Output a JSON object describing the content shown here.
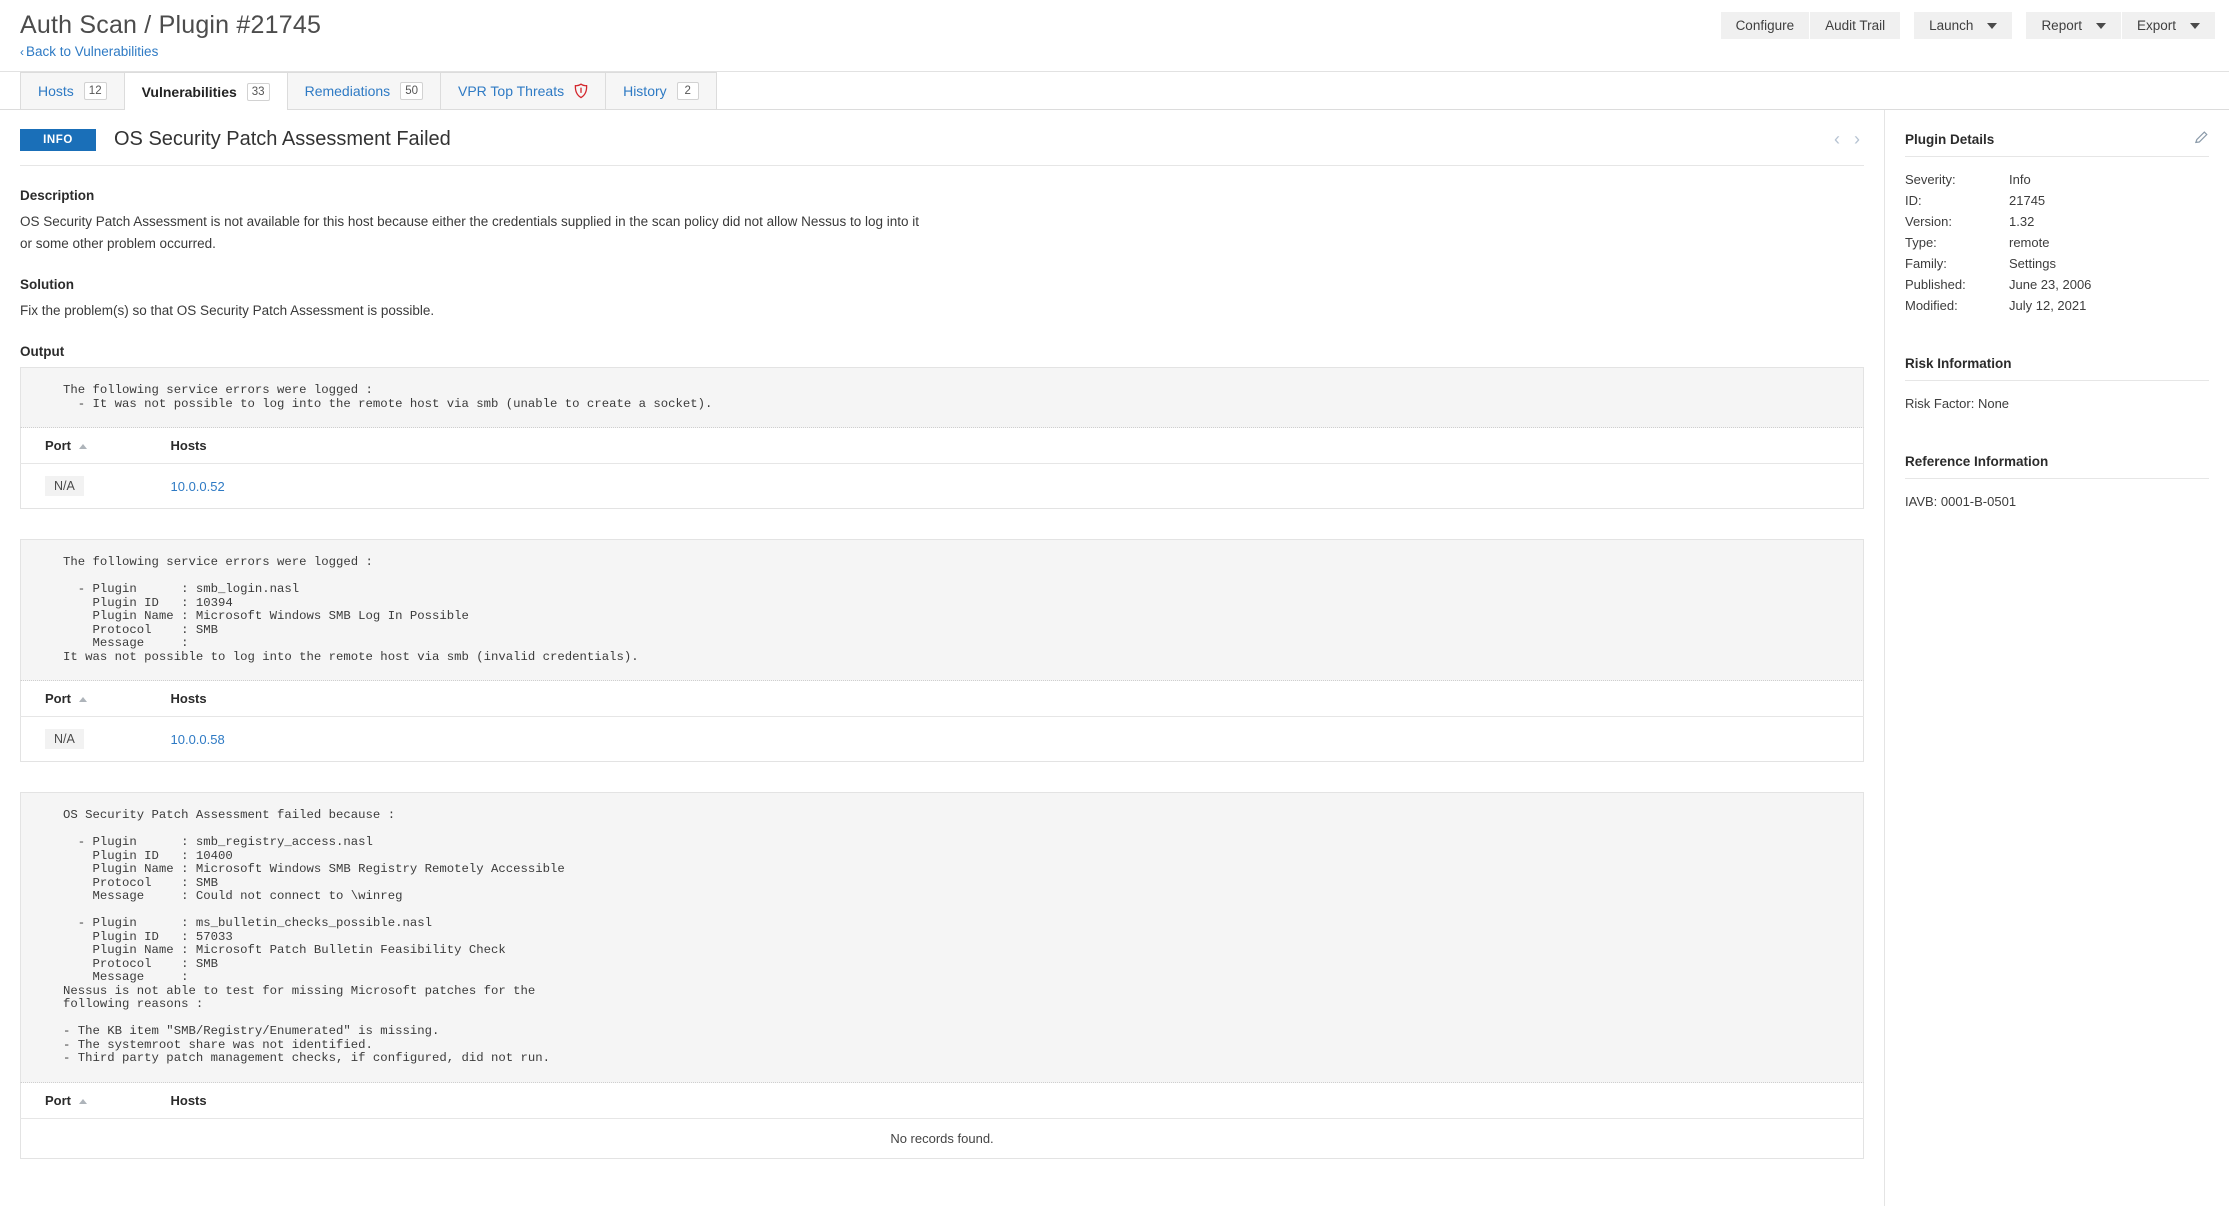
{
  "header": {
    "title": "Auth Scan / Plugin #21745",
    "back_link": "Back to Vulnerabilities",
    "back_chevron": "‹",
    "buttons": {
      "configure": "Configure",
      "audit_trail": "Audit Trail",
      "launch": "Launch",
      "report": "Report",
      "export": "Export"
    }
  },
  "tabs": [
    {
      "label": "Hosts",
      "count": "12",
      "active": false,
      "icon": ""
    },
    {
      "label": "Vulnerabilities",
      "count": "33",
      "active": true,
      "icon": ""
    },
    {
      "label": "Remediations",
      "count": "50",
      "active": false,
      "icon": ""
    },
    {
      "label": "VPR Top Threats",
      "count": "",
      "active": false,
      "icon": "shield-icon"
    },
    {
      "label": "History",
      "count": "2",
      "active": false,
      "icon": ""
    }
  ],
  "vulnerability": {
    "severity_badge": "INFO",
    "severity_color": "#1a6fb8",
    "title": "OS Security Patch Assessment Failed",
    "prev_arrow": "‹",
    "next_arrow": "›",
    "description_heading": "Description",
    "description": "OS Security Patch Assessment is not available for this host because either the credentials supplied in the scan policy did not allow Nessus to log into it or some other problem occurred.",
    "solution_heading": "Solution",
    "solution": "Fix the problem(s) so that OS Security Patch Assessment is possible.",
    "output_heading": "Output"
  },
  "table_headers": {
    "port": "Port",
    "hosts": "Hosts"
  },
  "empty_message": "No records found.",
  "output_blocks": [
    {
      "text": "The following service errors were logged :\n  - It was not possible to log into the remote host via smb (unable to create a socket).",
      "rows": [
        {
          "port": "N/A",
          "host": "10.0.0.52"
        }
      ],
      "empty": false
    },
    {
      "text": "The following service errors were logged :\n\n  - Plugin      : smb_login.nasl\n    Plugin ID   : 10394\n    Plugin Name : Microsoft Windows SMB Log In Possible\n    Protocol    : SMB\n    Message     :\nIt was not possible to log into the remote host via smb (invalid credentials).",
      "rows": [
        {
          "port": "N/A",
          "host": "10.0.0.58"
        }
      ],
      "empty": false
    },
    {
      "text": "OS Security Patch Assessment failed because :\n\n  - Plugin      : smb_registry_access.nasl\n    Plugin ID   : 10400\n    Plugin Name : Microsoft Windows SMB Registry Remotely Accessible\n    Protocol    : SMB\n    Message     : Could not connect to \\winreg\n\n  - Plugin      : ms_bulletin_checks_possible.nasl\n    Plugin ID   : 57033\n    Plugin Name : Microsoft Patch Bulletin Feasibility Check\n    Protocol    : SMB\n    Message     :\nNessus is not able to test for missing Microsoft patches for the\nfollowing reasons :\n\n- The KB item \"SMB/Registry/Enumerated\" is missing.\n- The systemroot share was not identified.\n- Third party patch management checks, if configured, did not run.",
      "rows": [],
      "empty": true
    }
  ],
  "plugin_details": {
    "heading": "Plugin Details",
    "fields": [
      {
        "label": "Severity:",
        "value": "Info"
      },
      {
        "label": "ID:",
        "value": "21745"
      },
      {
        "label": "Version:",
        "value": "1.32"
      },
      {
        "label": "Type:",
        "value": "remote"
      },
      {
        "label": "Family:",
        "value": "Settings"
      },
      {
        "label": "Published:",
        "value": "June 23, 2006"
      },
      {
        "label": "Modified:",
        "value": "July 12, 2021"
      }
    ]
  },
  "risk_information": {
    "heading": "Risk Information",
    "line": "Risk Factor: None"
  },
  "reference_information": {
    "heading": "Reference Information",
    "line": "IAVB:  0001-B-0501"
  }
}
